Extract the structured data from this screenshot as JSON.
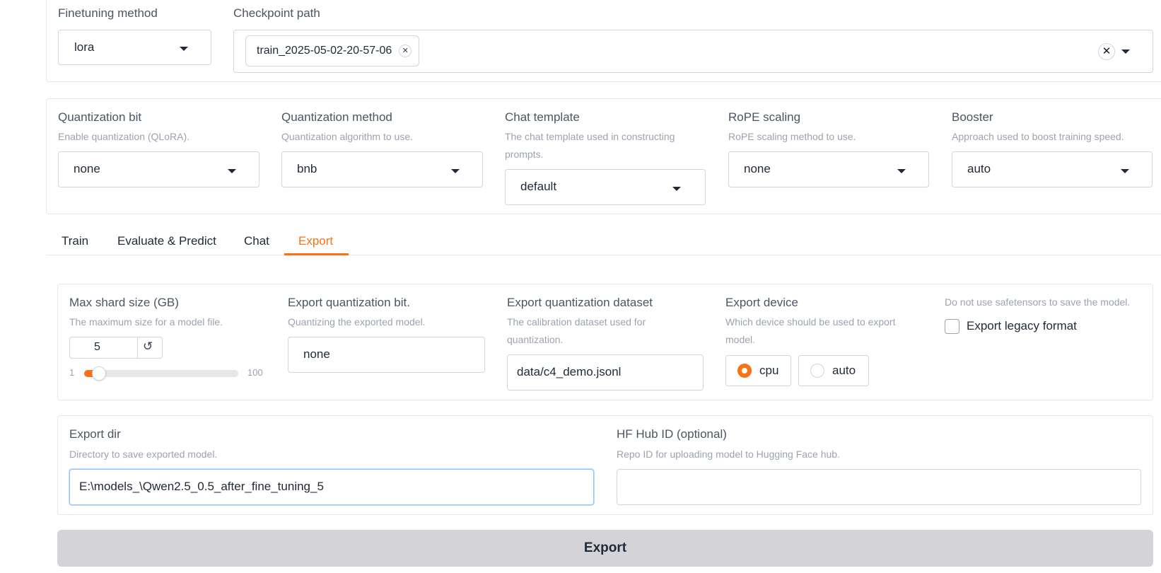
{
  "top": {
    "finetuning_method": {
      "label": "Finetuning method",
      "value": "lora"
    },
    "checkpoint_path": {
      "label": "Checkpoint path",
      "chip": "train_2025-05-02-20-57-06"
    }
  },
  "advanced": {
    "quantization_bit": {
      "label": "Quantization bit",
      "info": "Enable quantization (QLoRA).",
      "value": "none"
    },
    "quantization_method": {
      "label": "Quantization method",
      "info": "Quantization algorithm to use.",
      "value": "bnb"
    },
    "chat_template": {
      "label": "Chat template",
      "info_line1": "The chat template used in constructing",
      "info_line2": "prompts.",
      "value": "default"
    },
    "rope_scaling": {
      "label": "RoPE scaling",
      "info": "RoPE scaling method to use.",
      "value": "none"
    },
    "booster": {
      "label": "Booster",
      "info": "Approach used to boost training speed.",
      "value": "auto"
    }
  },
  "tabs": [
    {
      "label": "Train",
      "active": false
    },
    {
      "label": "Evaluate & Predict",
      "active": false
    },
    {
      "label": "Chat",
      "active": false
    },
    {
      "label": "Export",
      "active": true
    }
  ],
  "export": {
    "max_shard": {
      "label": "Max shard size (GB)",
      "info": "The maximum size for a model file.",
      "value": "5",
      "min": "1",
      "max": "100",
      "fraction": 0.04
    },
    "quant_bit": {
      "label": "Export quantization bit.",
      "info": "Quantizing the exported model.",
      "value": "none"
    },
    "quant_dataset": {
      "label": "Export quantization dataset",
      "info_line1": "The calibration dataset used for",
      "info_line2": "quantization.",
      "value": "data/c4_demo.jsonl"
    },
    "device": {
      "label": "Export device",
      "info_line1": "Which device should be used to export",
      "info_line2": "model.",
      "options": [
        "cpu",
        "auto"
      ],
      "selected": "cpu"
    },
    "legacy": {
      "info": "Do not use safetensors to save the model.",
      "label": "Export legacy format",
      "checked": false
    },
    "dir": {
      "label": "Export dir",
      "info": "Directory to save exported model.",
      "value": "E:\\models_\\Qwen2.5_0.5_after_fine_tuning_5"
    },
    "hub": {
      "label": "HF Hub ID (optional)",
      "info": "Repo ID for uploading model to Hugging Face hub.",
      "value": ""
    },
    "button": "Export"
  },
  "icons": {
    "reset": "reset-icon",
    "caret": "chevron-down-icon",
    "clear": "close-icon"
  },
  "colors": {
    "accent": "#f97316",
    "button_bg": "#d4d4d8",
    "focus_border": "#93c5fd"
  }
}
